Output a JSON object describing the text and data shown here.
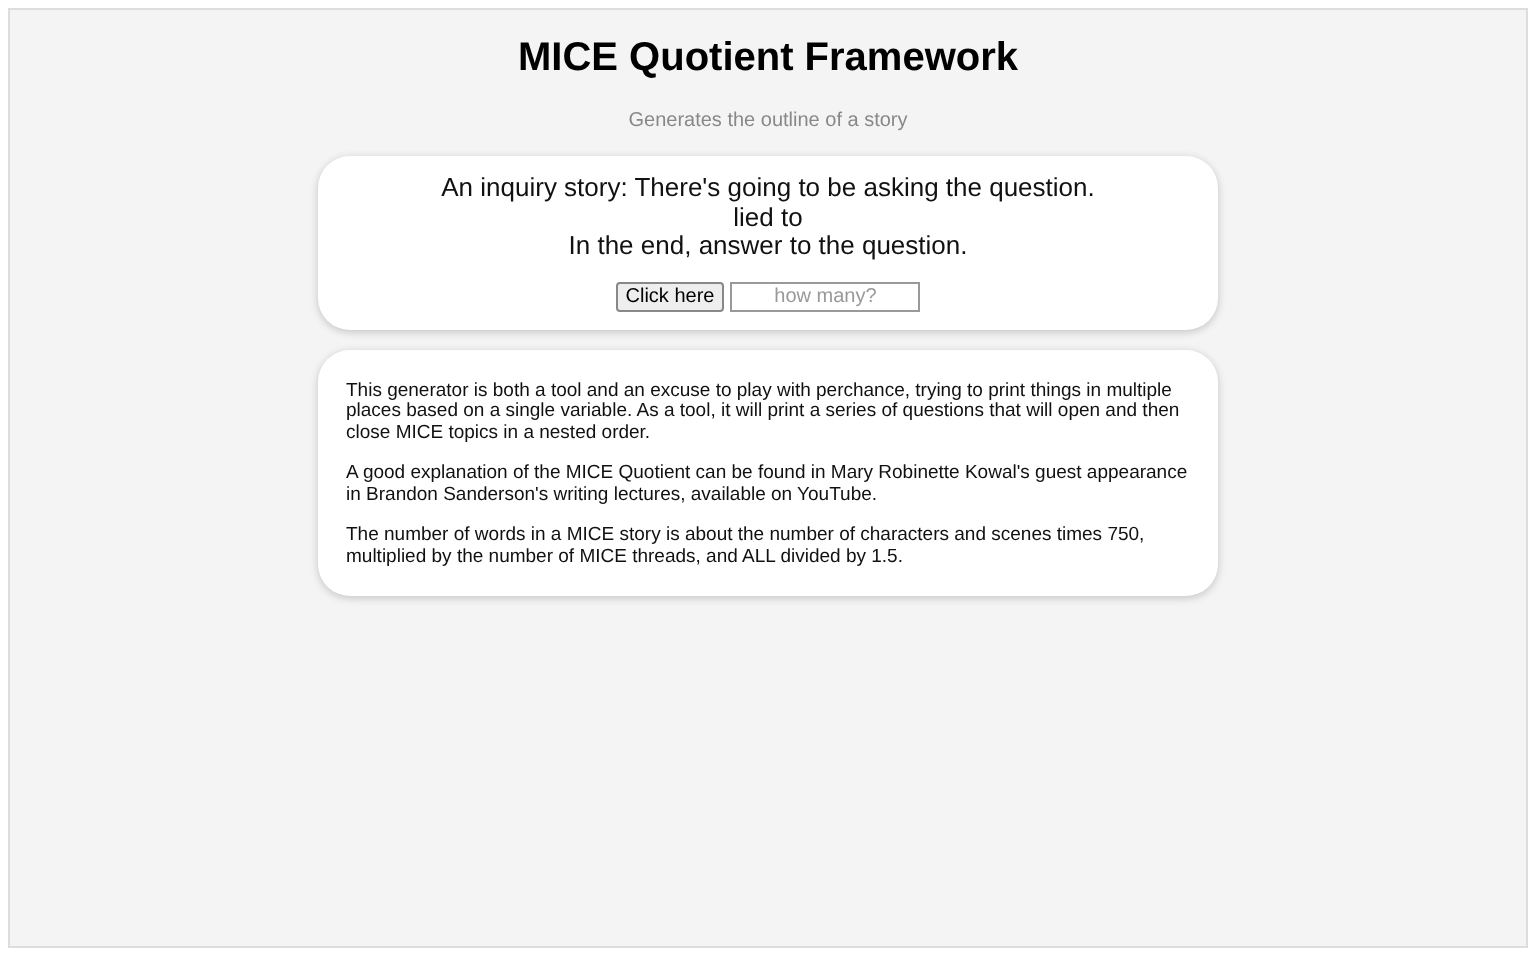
{
  "title": "MICE Quotient Framework",
  "subtitle": "Generates the outline of a story",
  "story_lines": [
    "An inquiry story: There's going to be asking the question.",
    "lied to",
    "In the end, answer to the question."
  ],
  "button": "Click here",
  "count_field": {
    "placeholder": "how many?"
  },
  "paragraphs": [
    "This generator is both a tool and an excuse to play with perchance, trying to print things in multiple places based on a single variable. As a tool, it will print a series of questions that will open and then close MICE topics in a nested order.",
    "A good explanation of the MICE Quotient can be found in Mary Robinette Kowal's guest appearance in Brandon Sanderson's writing lectures, available on YouTube.",
    "The number of words in a MICE story is about the number of characters and scenes times 750, multiplied by the number of MICE threads, and ALL divided by 1.5."
  ]
}
